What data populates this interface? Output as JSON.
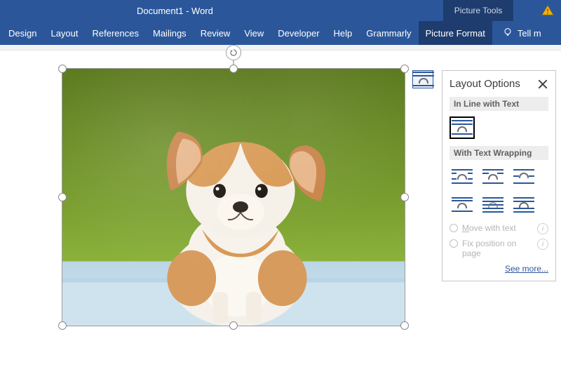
{
  "title": "Document1  -  Word",
  "tool_tab": "Picture Tools",
  "ribbon": {
    "tabs": [
      "Design",
      "Layout",
      "References",
      "Mailings",
      "Review",
      "View",
      "Developer",
      "Help",
      "Grammarly",
      "Picture Format"
    ],
    "active": "Picture Format",
    "tell_me": "Tell m"
  },
  "flyout": {
    "title": "Layout Options",
    "section_inline": "In Line with Text",
    "section_wrap": "With Text Wrapping",
    "options_inline": [
      "in-line-with-text"
    ],
    "options_wrap": [
      "square",
      "tight",
      "through",
      "top-and-bottom",
      "behind-text",
      "in-front-of-text"
    ],
    "selected": "in-line-with-text",
    "radios": {
      "move": "Move with text",
      "fix": "Fix position on page"
    },
    "see_more": "See more..."
  }
}
